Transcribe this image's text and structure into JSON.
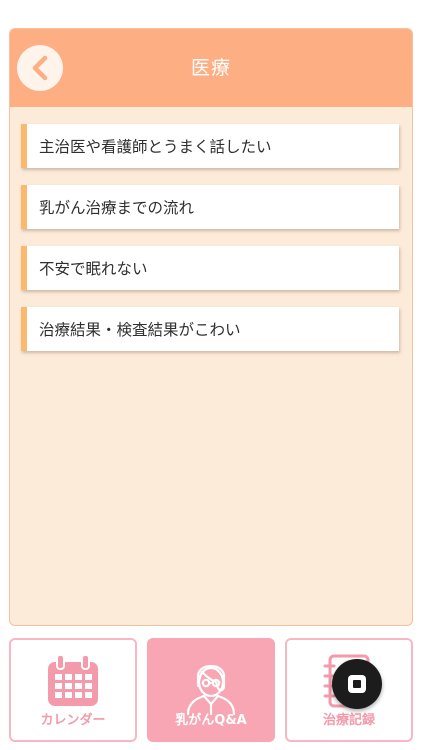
{
  "header": {
    "title": "医療",
    "back_icon": "chevron-left-icon"
  },
  "menu": {
    "items": [
      {
        "label": "主治医や看護師とうまく話したい"
      },
      {
        "label": "乳がん治療までの流れ"
      },
      {
        "label": "不安で眠れない"
      },
      {
        "label": "治療結果・検査結果がこわい"
      }
    ]
  },
  "tabbar": {
    "tabs": [
      {
        "label": "カレンダー",
        "icon": "calendar-icon",
        "active": false
      },
      {
        "label": "乳がんQ&A",
        "icon": "doctor-icon",
        "active": true
      },
      {
        "label": "治療記録",
        "icon": "notebook-icon",
        "active": false
      }
    ]
  },
  "overlay": {
    "icon": "stop-square-icon"
  },
  "colors": {
    "header": "#fdae83",
    "panel": "#fdebd9",
    "item_accent": "#fbb96e",
    "tab_pink": "#f8a6b4"
  }
}
